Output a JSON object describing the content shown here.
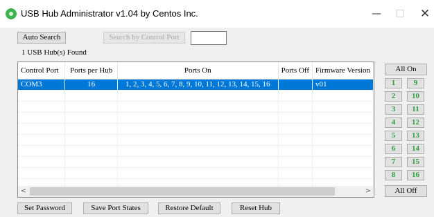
{
  "window": {
    "title": "USB Hub Administrator v1.04 by Centos Inc.",
    "minimize_glyph": "—",
    "maximize_glyph": "☐",
    "close_glyph": "✕",
    "app_icon": "usb-hub-app-icon"
  },
  "toolbar": {
    "auto_search_label": "Auto Search",
    "search_by_control_port_label": "Search by Control Port",
    "control_port_value": ""
  },
  "status": {
    "found_text": "1 USB Hub(s) Found"
  },
  "table": {
    "headers": [
      "Control Port",
      "Ports per Hub",
      "Ports On",
      "Ports Off",
      "Firmware Version"
    ],
    "rows": [
      [
        "COM3",
        "16",
        "1, 2, 3, 4, 5, 6, 7, 8, 9, 10, 11, 12, 13, 14, 15, 16",
        "",
        "v01"
      ]
    ],
    "selected_row": 0,
    "scroll_left_glyph": "<",
    "scroll_right_glyph": ">"
  },
  "ports": {
    "all_on_label": "All On",
    "all_off_label": "All Off",
    "left_column": [
      "1",
      "2",
      "3",
      "4",
      "5",
      "6",
      "7",
      "8"
    ],
    "right_column": [
      "9",
      "10",
      "11",
      "12",
      "13",
      "14",
      "15",
      "16"
    ],
    "label_color": "#2e9e3e"
  },
  "footer": {
    "set_password_label": "Set Password",
    "save_port_states_label": "Save Port States",
    "restore_default_label": "Restore Default",
    "reset_hub_label": "Reset Hub"
  },
  "colors": {
    "selection": "#0078d7",
    "window_background": "#f0f0f0"
  }
}
